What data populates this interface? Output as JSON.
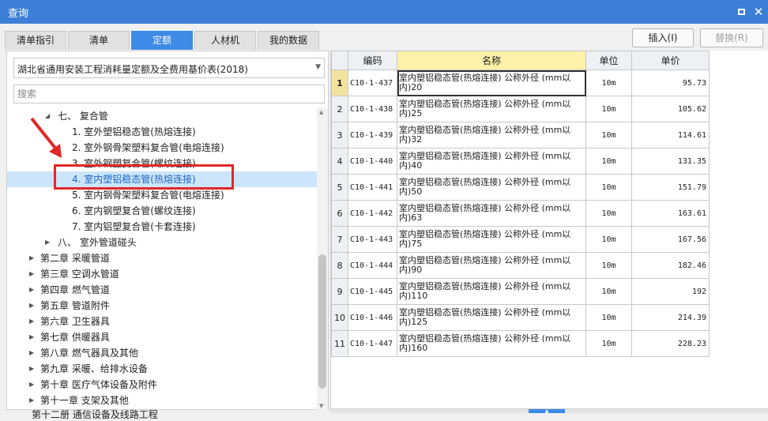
{
  "window": {
    "title": "查询"
  },
  "tabs": [
    "清单指引",
    "清单",
    "定额",
    "人材机",
    "我的数据"
  ],
  "active_tab": 2,
  "buttons": {
    "insert": "插入(I)",
    "replace": "替换(R)"
  },
  "library_select": {
    "value": "湖北省通用安装工程消耗量定额及全费用基价表(2018)"
  },
  "search": {
    "placeholder": "搜索"
  },
  "tree": [
    {
      "label": "七、 复合管",
      "level": 1,
      "arrow": "expanded"
    },
    {
      "label": "1. 室外塑铝稳态管(热熔连接)",
      "level": 2
    },
    {
      "label": "2. 室外钢骨架塑料复合管(电熔连接)",
      "level": 2
    },
    {
      "label": "3. 室外钢塑复合管(螺纹连接)",
      "level": 2
    },
    {
      "label": "4. 室内塑铝稳态管(热熔连接)",
      "level": 2,
      "selected": true
    },
    {
      "label": "5. 室内钢骨架塑料复合管(电熔连接)",
      "level": 2
    },
    {
      "label": "6. 室内钢塑复合管(螺纹连接)",
      "level": 2
    },
    {
      "label": "7. 室内铝塑复合管(卡套连接)",
      "level": 2
    },
    {
      "label": "八、 室外管道碰头",
      "level": 1,
      "arrow": "collapsed"
    },
    {
      "label": "第二章 采暖管道",
      "level": 0,
      "arrow": "collapsed"
    },
    {
      "label": "第三章 空调水管道",
      "level": 0,
      "arrow": "collapsed"
    },
    {
      "label": "第四章 燃气管道",
      "level": 0,
      "arrow": "collapsed"
    },
    {
      "label": "第五章 管道附件",
      "level": 0,
      "arrow": "collapsed"
    },
    {
      "label": "第六章 卫生器具",
      "level": 0,
      "arrow": "collapsed"
    },
    {
      "label": "第七章 供暖器具",
      "level": 0,
      "arrow": "collapsed"
    },
    {
      "label": "第八章 燃气器具及其他",
      "level": 0,
      "arrow": "collapsed"
    },
    {
      "label": "第九章 采暖、给排水设备",
      "level": 0,
      "arrow": "collapsed"
    },
    {
      "label": "第十章 医疗气体设备及附件",
      "level": 0,
      "arrow": "collapsed"
    },
    {
      "label": "第十一章 支架及其他",
      "level": 0,
      "arrow": "collapsed"
    }
  ],
  "tree_cut_text": "第十二册 通信设备及线路工程",
  "table": {
    "headers": [
      "编码",
      "名称",
      "单位",
      "单价"
    ],
    "rows": [
      {
        "no": "1",
        "code": "C10-1-437",
        "name": "室内塑铝稳态管(热熔连接) 公称外径 (mm以内)20",
        "unit": "10m",
        "price": "95.73"
      },
      {
        "no": "2",
        "code": "C10-1-438",
        "name": "室内塑铝稳态管(热熔连接) 公称外径 (mm以内)25",
        "unit": "10m",
        "price": "105.62"
      },
      {
        "no": "3",
        "code": "C10-1-439",
        "name": "室内塑铝稳态管(热熔连接) 公称外径 (mm以内)32",
        "unit": "10m",
        "price": "114.61"
      },
      {
        "no": "4",
        "code": "C10-1-440",
        "name": "室内塑铝稳态管(热熔连接) 公称外径 (mm以内)40",
        "unit": "10m",
        "price": "131.35"
      },
      {
        "no": "5",
        "code": "C10-1-441",
        "name": "室内塑铝稳态管(热熔连接) 公称外径 (mm以内)50",
        "unit": "10m",
        "price": "151.79"
      },
      {
        "no": "6",
        "code": "C10-1-442",
        "name": "室内塑铝稳态管(热熔连接) 公称外径 (mm以内)63",
        "unit": "10m",
        "price": "163.61"
      },
      {
        "no": "7",
        "code": "C10-1-443",
        "name": "室内塑铝稳态管(热熔连接) 公称外径 (mm以内)75",
        "unit": "10m",
        "price": "167.56"
      },
      {
        "no": "8",
        "code": "C10-1-444",
        "name": "室内塑铝稳态管(热熔连接) 公称外径 (mm以内)90",
        "unit": "10m",
        "price": "182.46"
      },
      {
        "no": "9",
        "code": "C10-1-445",
        "name": "室内塑铝稳态管(热熔连接) 公称外径 (mm以内)110",
        "unit": "10m",
        "price": "192"
      },
      {
        "no": "10",
        "code": "C10-1-446",
        "name": "室内塑铝稳态管(热熔连接) 公称外径 (mm以内)125",
        "unit": "10m",
        "price": "214.39"
      },
      {
        "no": "11",
        "code": "C10-1-447",
        "name": "室内塑铝稳态管(热熔连接) 公称外径 (mm以内)160",
        "unit": "10m",
        "price": "228.23"
      }
    ]
  },
  "colors": {
    "titlebar": "#3d7fd6",
    "active_tab": "#3d8be6",
    "highlight_box": "#e02828",
    "selected_row": "#cce5fa"
  },
  "icons": {
    "maximize": "maximize-icon",
    "close": "close-icon",
    "annotation": "red-arrow-icon"
  }
}
